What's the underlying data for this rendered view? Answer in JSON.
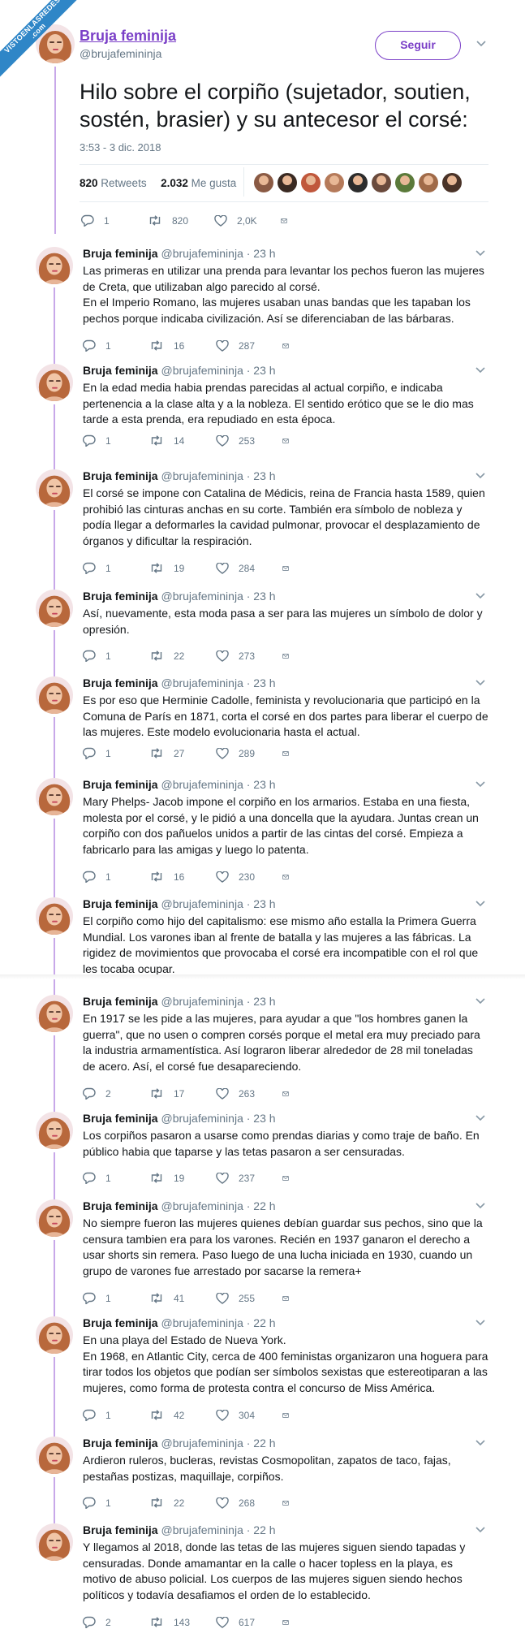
{
  "watermark": {
    "line1": "VISTOENLASREDES",
    "line2": ".com"
  },
  "author": {
    "name": "Bruja feminija",
    "display_name": "Bruja feminija",
    "handle": "@brujafemininja"
  },
  "main": {
    "name": "Bruja feminija",
    "handle": "@brujafemininja",
    "follow_label": "Seguir",
    "text": "Hilo sobre el corpiño (sujetador, soutien, sostén, brasier) y su antecesor el corsé:",
    "time": "3:53 - 3 dic. 2018",
    "retweets_count": "820",
    "retweets_label": "Retweets",
    "likes_count": "2.032",
    "likes_label": "Me gusta",
    "replies": "1",
    "rts": "820",
    "likes": "2,0K",
    "liker_colors": [
      "#8a5a44",
      "#3a2a22",
      "#c0583c",
      "#b57a5a",
      "#2c2c2c",
      "#6a4a3c",
      "#5b7a3a",
      "#a06a48",
      "#4a3328"
    ]
  },
  "colors": {
    "accent": "#7a3fc7",
    "thread": "#c8a8e9",
    "muted": "#657786"
  },
  "tweets": [
    {
      "name": "Bruja feminija",
      "handle": "@brujafemininja",
      "time": "· 23 h",
      "text": "Las primeras en utilizar una prenda para levantar los pechos fueron las mujeres de Creta, que utilizaban algo parecido al corsé.\nEn el Imperio Romano, las mujeres usaban unas bandas que les tapaban los pechos porque indicaba civilización. Así se diferenciaban de las bárbaras.",
      "replies": "1",
      "rts": "16",
      "likes": "287"
    },
    {
      "name": "Bruja feminija",
      "handle": "@brujafemininja",
      "time": "· 23 h",
      "text": "En la edad media habia prendas parecidas al actual corpiño, e indicaba pertenencia a la clase alta y a la nobleza. El sentido erótico que se le dio mas tarde a esta prenda, era repudiado en esta época.",
      "replies": "1",
      "rts": "14",
      "likes": "253"
    },
    {
      "name": "Bruja feminija",
      "handle": "@brujafemininja",
      "time": "· 23 h",
      "text": "El corsé se impone con Catalina de Médicis, reina de Francia hasta 1589, quien prohibió las cinturas anchas en su corte. También era símbolo de nobleza y podía llegar a deformarles la cavidad pulmonar, provocar el desplazamiento de órganos y dificultar la respiración.",
      "replies": "1",
      "rts": "19",
      "likes": "284"
    },
    {
      "name": "Bruja feminija",
      "handle": "@brujafemininja",
      "time": "· 23 h",
      "text": "Así, nuevamente, esta moda pasa a ser para las mujeres un símbolo de dolor y opresión.",
      "replies": "1",
      "rts": "22",
      "likes": "273"
    },
    {
      "name": "Bruja feminija",
      "handle": "@brujafemininja",
      "time": "· 23 h",
      "text": "Es por eso que Herminie Cadolle, feminista y revolucionaria que participó en la Comuna de París en 1871, corta el corsé en dos partes para liberar el cuerpo de las mujeres. Este modelo evolucionaria hasta el actual.",
      "replies": "1",
      "rts": "27",
      "likes": "289"
    },
    {
      "name": "Bruja feminija",
      "handle": "@brujafemininja",
      "time": "· 23 h",
      "text": "Mary Phelps- Jacob impone el corpiño en los armarios. Estaba en una fiesta, molesta por el corsé, y le pidió a una doncella que la ayudara. Juntas crean un corpiño con dos pañuelos unidos a partir de las cintas del corsé. Empieza a fabricarlo para las amigas y luego lo patenta.",
      "replies": "1",
      "rts": "16",
      "likes": "230"
    },
    {
      "name": "Bruja feminija",
      "handle": "@brujafemininja",
      "time": "· 23 h",
      "text": "El corpiño como hijo del capitalismo: ese mismo año estalla la Primera Guerra Mundial. Los varones iban al frente de batalla y las mujeres a las fábricas. La rigidez de movimientos que provocaba el corsé era incompatible con el rol que les tocaba ocupar.",
      "replies": "",
      "rts": "",
      "likes": ""
    },
    {
      "name": "Bruja feminija",
      "handle": "@brujafemininja",
      "time": "· 23 h",
      "text": "En 1917 se les pide a las mujeres, para ayudar a que \"los hombres ganen la guerra\", que no usen o compren corsés porque el metal era muy preciado para la industria armamentística. Así lograron liberar alrededor de 28 mil toneladas de acero. Así, el corsé fue desapareciendo.",
      "replies": "2",
      "rts": "17",
      "likes": "263"
    },
    {
      "name": "Bruja feminija",
      "handle": "@brujafemininja",
      "time": "· 23 h",
      "text": "Los corpiños pasaron a usarse como prendas diarias y como traje de baño. En público habia que taparse y las tetas pasaron a ser censuradas.",
      "replies": "1",
      "rts": "19",
      "likes": "237"
    },
    {
      "name": "Bruja feminija",
      "handle": "@brujafemininja",
      "time": "· 22 h",
      "text": "No siempre fueron las mujeres quienes debían guardar sus pechos, sino que la censura tambien era para los varones. Recién en 1937 ganaron el derecho a usar shorts sin remera. Paso luego de una lucha iniciada en 1930, cuando un grupo de varones fue arrestado por sacarse la remera+",
      "replies": "1",
      "rts": "41",
      "likes": "255"
    },
    {
      "name": "Bruja feminija",
      "handle": "@brujafemininja",
      "time": "· 22 h",
      "text": "En una playa del Estado de Nueva York.\nEn 1968, en Atlantic City, cerca de 400 feministas organizaron una hoguera para tirar todos los objetos que podían ser símbolos sexistas que estereotiparan a las mujeres, como forma de protesta contra el concurso de Miss América.",
      "replies": "1",
      "rts": "42",
      "likes": "304"
    },
    {
      "name": "Bruja feminija",
      "handle": "@brujafemininja",
      "time": "· 22 h",
      "text": "Ardieron ruleros, bucleras, revistas Cosmopolitan, zapatos de taco, fajas, pestañas postizas, maquillaje, corpiños.",
      "replies": "1",
      "rts": "22",
      "likes": "268"
    },
    {
      "name": "Bruja feminija",
      "handle": "@brujafemininja",
      "time": "· 22 h",
      "text": "Y llegamos al 2018, donde las tetas de las mujeres siguen siendo tapadas y censuradas. Donde amamantar en la calle o hacer topless en la playa, es motivo de abuso policial. Los cuerpos de las mujeres siguen siendo hechos políticos y todavía desafiamos el orden de lo establecido.",
      "replies": "2",
      "rts": "143",
      "likes": "617"
    }
  ]
}
